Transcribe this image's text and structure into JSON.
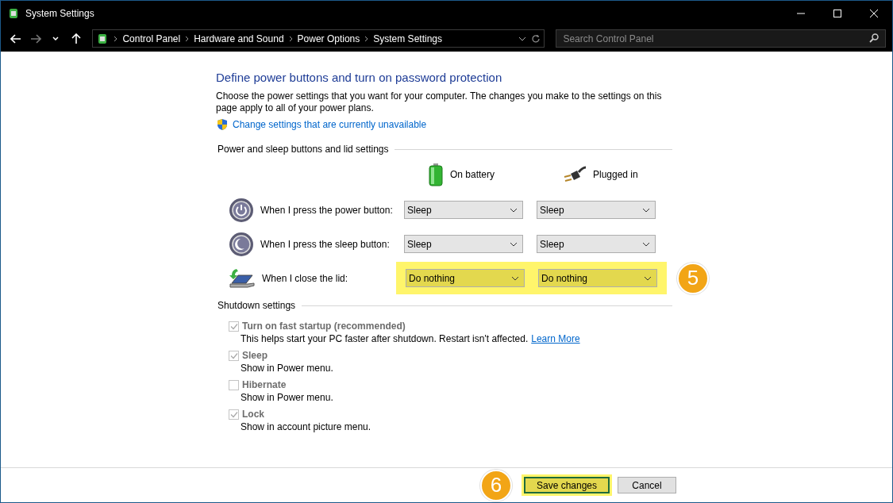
{
  "window": {
    "title": "System Settings"
  },
  "address_bar": {
    "breadcrumbs": [
      "Control Panel",
      "Hardware and Sound",
      "Power Options",
      "System Settings"
    ]
  },
  "search": {
    "placeholder": "Search Control Panel"
  },
  "heading": "Define power buttons and turn on password protection",
  "description": "Choose the power settings that you want for your computer. The changes you make to the settings on this page apply to all of your power plans.",
  "admin_link": "Change settings that are currently unavailable",
  "power_section": {
    "title": "Power and sleep buttons and lid settings",
    "columns": [
      {
        "kind": "battery",
        "label": "On battery"
      },
      {
        "kind": "plug",
        "label": "Plugged in"
      }
    ],
    "rows": [
      {
        "kind": "power",
        "label": "When I press the power button:",
        "values": [
          "Sleep",
          "Sleep"
        ],
        "highlighted": false
      },
      {
        "kind": "sleep",
        "label": "When I press the sleep button:",
        "values": [
          "Sleep",
          "Sleep"
        ],
        "highlighted": false
      },
      {
        "kind": "lid",
        "label": "When I close the lid:",
        "values": [
          "Do nothing",
          "Do nothing"
        ],
        "highlighted": true,
        "callout": "5"
      }
    ]
  },
  "shutdown_section": {
    "title": "Shutdown settings",
    "items": [
      {
        "label": "Turn on fast startup (recommended)",
        "description": "This helps start your PC faster after shutdown. Restart isn't affected.",
        "link": "Learn More",
        "checked": true,
        "disabled": true
      },
      {
        "label": "Sleep",
        "description": "Show in Power menu.",
        "checked": true,
        "disabled": true
      },
      {
        "label": "Hibernate",
        "description": "Show in Power menu.",
        "checked": false,
        "disabled": true
      },
      {
        "label": "Lock",
        "description": "Show in account picture menu.",
        "checked": true,
        "disabled": true
      }
    ]
  },
  "footer": {
    "callout": "6",
    "buttons": [
      {
        "label": "Save changes",
        "highlighted": true
      },
      {
        "label": "Cancel",
        "highlighted": false
      }
    ]
  }
}
